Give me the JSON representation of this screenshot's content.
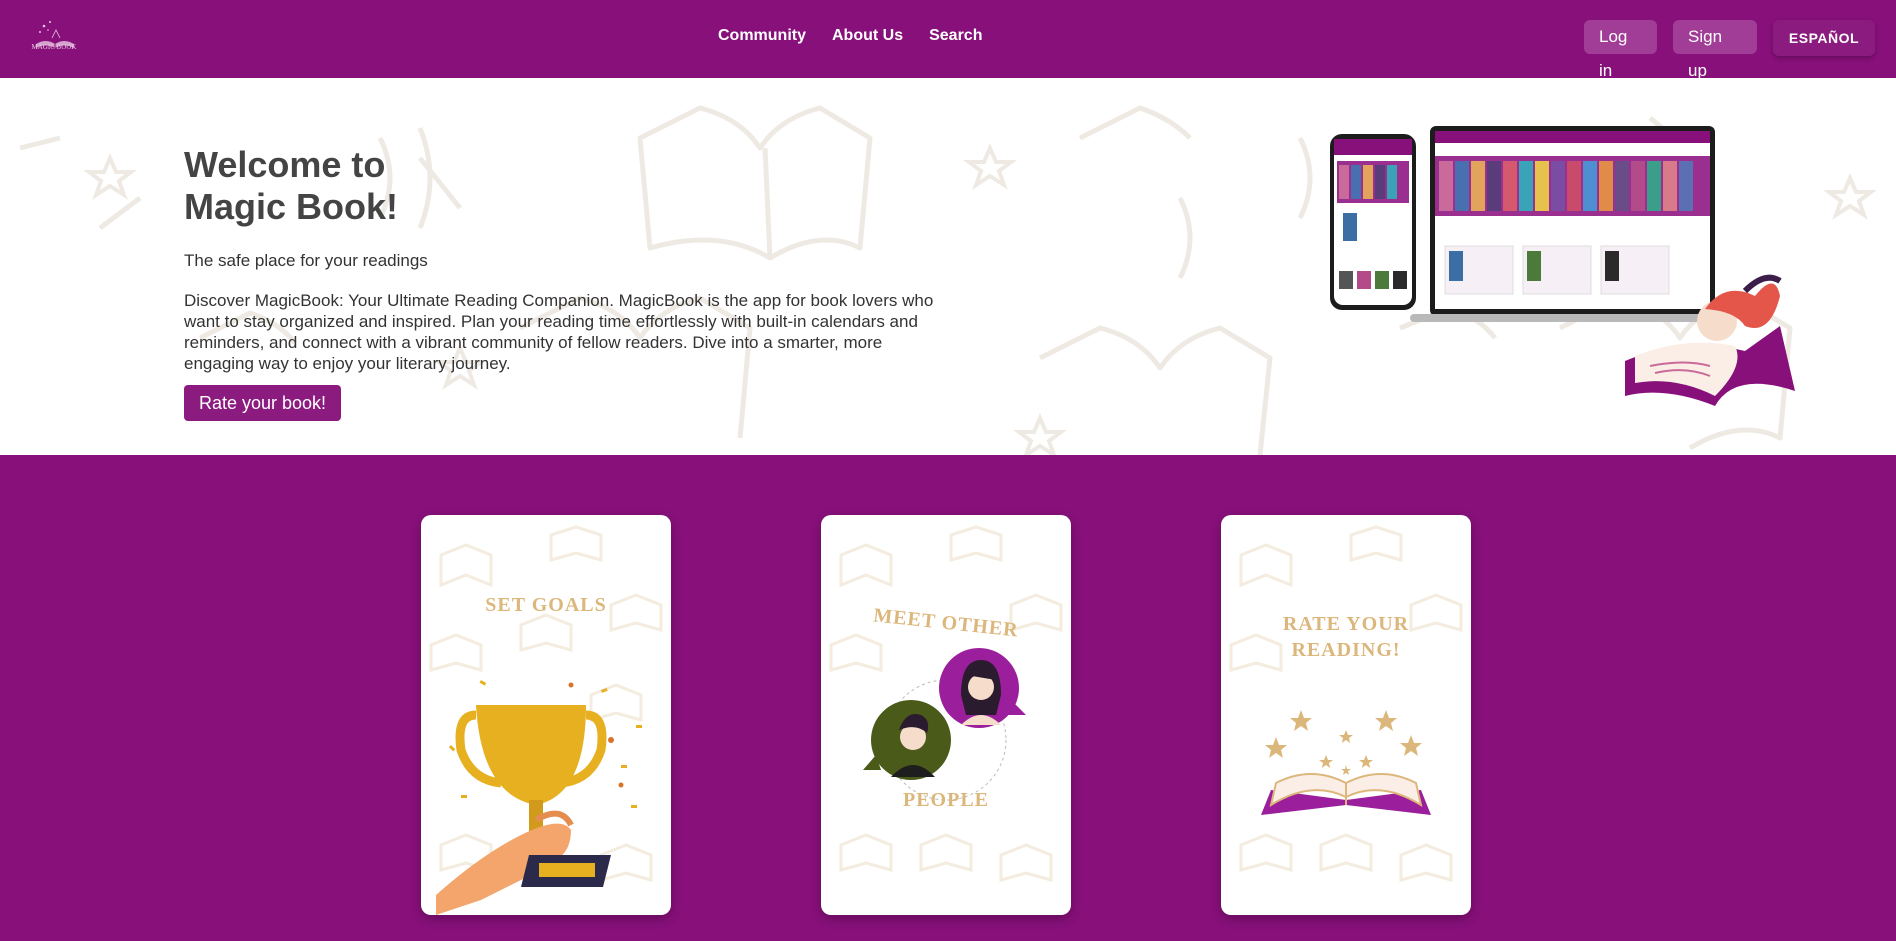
{
  "nav": {
    "logo_text": "MAGIC BOOK",
    "links": [
      {
        "label": "Community"
      },
      {
        "label": "About Us"
      },
      {
        "label": "Search"
      }
    ],
    "login_label": "Log in",
    "signup_label": "Sign up",
    "language_label": "ESPAÑOL"
  },
  "hero": {
    "title_line1": "Welcome to",
    "title_line2": "Magic Book!",
    "subtitle": "The safe place for your readings",
    "description": "Discover MagicBook: Your Ultimate Reading Companion. MagicBook is the app for book lovers who want to stay organized and inspired. Plan your reading time effortlessly with built-in calendars and reminders, and connect with a vibrant community of fellow readers. Dive into a smarter, more engaging way to enjoy your literary journey.",
    "cta_label": "Rate your book!"
  },
  "cards": [
    {
      "title_line1": "SET GOALS",
      "title_line2": ""
    },
    {
      "title_line1": "MEET OTHER",
      "title_line2": "PEOPLE"
    },
    {
      "title_line1": "RATE YOUR",
      "title_line2": "READING!"
    }
  ],
  "colors": {
    "brand": "#87107a",
    "button": "#a13d97",
    "card_title": "#dcb77c"
  }
}
